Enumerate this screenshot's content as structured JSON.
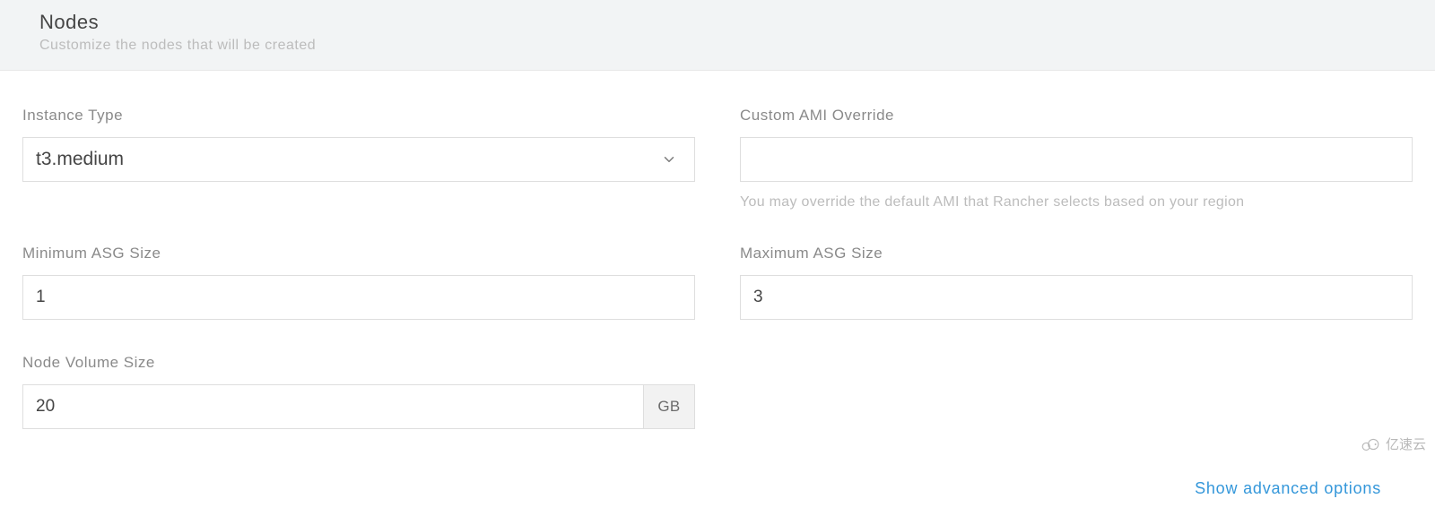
{
  "header": {
    "title": "Nodes",
    "subtitle": "Customize the nodes that will be created"
  },
  "instance_type": {
    "label": "Instance Type",
    "value": "t3.medium"
  },
  "custom_ami": {
    "label": "Custom AMI Override",
    "value": "",
    "help": "You may override the default AMI that Rancher selects based on your region"
  },
  "min_asg": {
    "label": "Minimum ASG Size",
    "value": "1"
  },
  "max_asg": {
    "label": "Maximum ASG Size",
    "value": "3"
  },
  "node_volume": {
    "label": "Node Volume Size",
    "value": "20",
    "unit": "GB"
  },
  "footer": {
    "advanced": "Show advanced options"
  },
  "watermark": "亿速云"
}
